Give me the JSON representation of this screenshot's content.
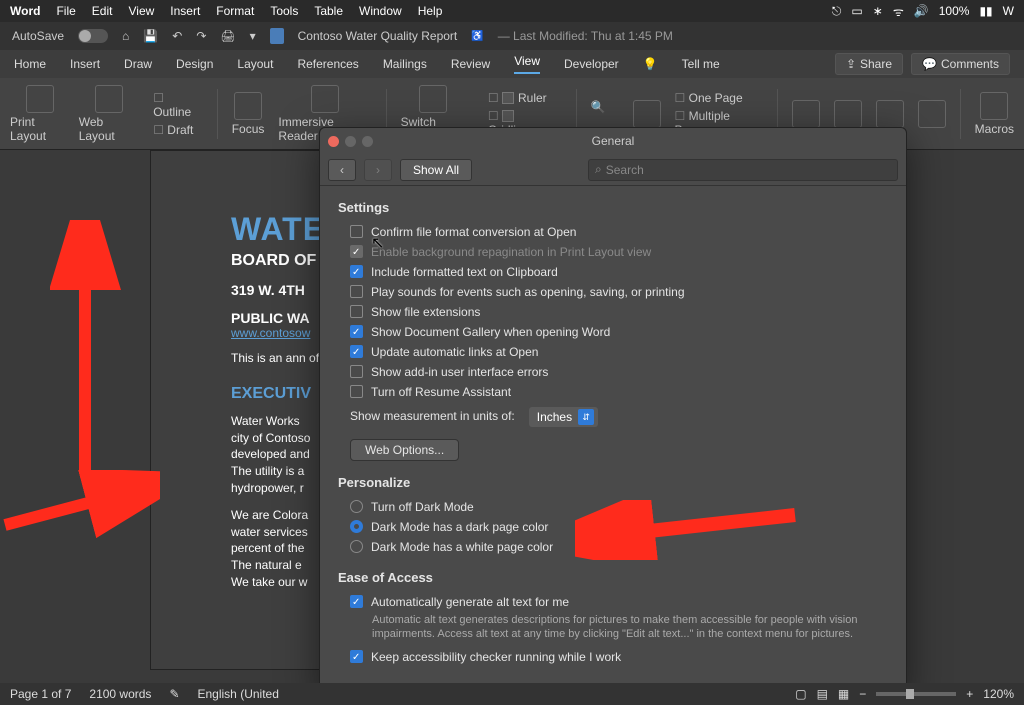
{
  "menubar": {
    "app": "Word",
    "items": [
      "File",
      "Edit",
      "View",
      "Insert",
      "Format",
      "Tools",
      "Table",
      "Window",
      "Help"
    ],
    "battery": "100%",
    "battery_icon": "⏻",
    "clock_wifi": "ᯤ"
  },
  "titlebar": {
    "autosave": "AutoSave",
    "doc": "Contoso Water Quality Report",
    "modified": "— Last Modified: Thu at 1:45 PM"
  },
  "ribbon": {
    "tabs": [
      "Home",
      "Insert",
      "Draw",
      "Design",
      "Layout",
      "References",
      "Mailings",
      "Review",
      "View",
      "Developer"
    ],
    "tellme": "Tell me",
    "share": "Share",
    "comments": "Comments",
    "print_layout": "Print Layout",
    "web_layout": "Web Layout",
    "outline": "Outline",
    "draft": "Draft",
    "focus": "Focus",
    "immersive": "Immersive Reader",
    "switch": "Switch Mode",
    "ruler": "Ruler",
    "gridlines": "Gridlines",
    "one_page": "One Page",
    "multi_pages": "Multiple Pages",
    "macros": "Macros"
  },
  "doc": {
    "title": "WATE",
    "board": "BOARD OF",
    "addr1": "319 W. 4TH",
    "addr2": "PUBLIC WA",
    "link": "www.contosow",
    "p1": "This is an ann of Contoso, wi",
    "exec": "EXECUTIV",
    "p2a": "Water Works",
    "p2b": "city of Contoso",
    "p2c": "developed and",
    "p2d": "The utility is a",
    "p2e": "hydropower, r",
    "p3a": "We are Colora",
    "p3b": "water services",
    "p3c": "percent of the",
    "p3d": "The natural e",
    "p3e": "We take our w"
  },
  "dlg": {
    "title": "General",
    "showall": "Show All",
    "search_ph": "Search",
    "settings_h": "Settings",
    "opts": {
      "confirm": "Confirm file format conversion at Open",
      "repag": "Enable background repagination in Print Layout view",
      "clip": "Include formatted text on Clipboard",
      "sounds": "Play sounds for events such as opening, saving, or printing",
      "ext": "Show file extensions",
      "gallery": "Show Document Gallery when opening Word",
      "links": "Update automatic links at Open",
      "addin": "Show add-in user interface errors",
      "resume": "Turn off Resume Assistant"
    },
    "units_lbl": "Show measurement in units of:",
    "units_val": "Inches",
    "webopts": "Web Options...",
    "pers_h": "Personalize",
    "dm_off": "Turn off Dark Mode",
    "dm_dark": "Dark Mode has a dark page color",
    "dm_white": "Dark Mode has a white page color",
    "ease_h": "Ease of Access",
    "alt": "Automatically generate alt text for me",
    "alt_sub": "Automatic alt text generates descriptions for pictures to make them accessible for people with vision impairments. Access alt text at any time by clicking \"Edit alt text...\" in the context menu for pictures.",
    "acc": "Keep accessibility checker running while I work"
  },
  "status": {
    "page": "Page 1 of 7",
    "words": "2100 words",
    "lang": "English (United",
    "zoom": "120%"
  }
}
